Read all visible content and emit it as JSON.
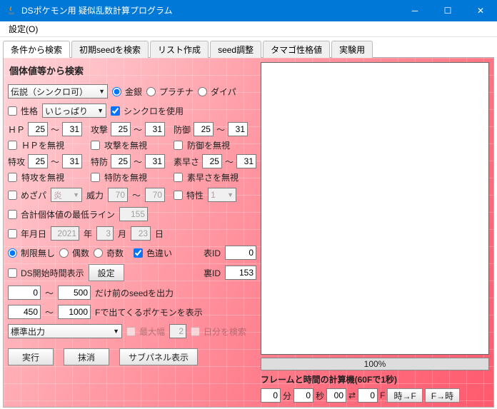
{
  "window": {
    "title": "DSポケモン用 疑似乱数計算プログラム"
  },
  "menu": {
    "settings": "設定(O)"
  },
  "tabs": {
    "t0": "条件から検索",
    "t1": "初期seedを検索",
    "t2": "リスト作成",
    "t3": "seed調整",
    "t4": "タマゴ性格値",
    "t5": "実験用"
  },
  "heading": "個体値等から検索",
  "encounter": {
    "value": "伝説（シンクロ可）"
  },
  "games": {
    "gs": "金銀",
    "pt": "プラチナ",
    "dp": "ダイパ"
  },
  "nature": {
    "label": "性格",
    "value": "いじっぱり",
    "sync": "シンクロを使用"
  },
  "iv": {
    "hp": "ＨＰ",
    "atk": "攻撃",
    "def": "防御",
    "spa": "特攻",
    "spd": "特防",
    "spe": "素早さ",
    "hp_lo": "25",
    "hp_hi": "31",
    "atk_lo": "25",
    "atk_hi": "31",
    "def_lo": "25",
    "def_hi": "31",
    "spa_lo": "25",
    "spa_hi": "31",
    "spd_lo": "25",
    "spd_hi": "31",
    "spe_lo": "25",
    "spe_hi": "31",
    "hp_ign": "ＨＰを無視",
    "atk_ign": "攻撃を無視",
    "def_ign": "防御を無視",
    "spa_ign": "特攻を無視",
    "spd_ign": "特防を無視",
    "spe_ign": "素早さを無視"
  },
  "hidden": {
    "label": "めざパ",
    "type": "炎",
    "power_label": "威力",
    "power_lo": "70",
    "power_hi": "70",
    "ability_label": "特性",
    "ability_val": "1"
  },
  "totaliv": {
    "label": "合計個体値の最低ライン",
    "val": "155"
  },
  "date": {
    "label": "年月日",
    "y": "2021",
    "y_suf": "年",
    "m": "3",
    "m_suf": "月",
    "d": "23",
    "d_suf": "日"
  },
  "limits": {
    "none": "制限無し",
    "even": "偶数",
    "odd": "奇数",
    "shiny": "色違い",
    "front_id": "表ID",
    "front_val": "0",
    "back_id": "裏ID",
    "back_val": "153"
  },
  "dsstart": {
    "label": "DS開始時間表示",
    "btn": "設定"
  },
  "seedrange": {
    "sep": "～",
    "lo": "0",
    "hi": "500",
    "suf": "だけ前のseedを出力"
  },
  "framerange": {
    "lo": "450",
    "hi": "1000",
    "suf": "Fで出てくるポケモンを表示"
  },
  "outmode": {
    "value": "標準出力",
    "maxw": "最大幅",
    "maxw_val": "2",
    "maxw_suf": "日分を検索"
  },
  "actions": {
    "run": "実行",
    "clear": "抹消",
    "subpanel": "サブパネル表示"
  },
  "progress": "100%",
  "frametime": {
    "title": "フレームと時間の計算機(60Fで1秒)",
    "min": "0",
    "min_u": "分",
    "sec": "0",
    "sec_u": "秒",
    "csec": "00",
    "swap": "⇄",
    "fval": "0",
    "f_u": "F",
    "to_f": "時→F",
    "to_t": "F→時"
  }
}
